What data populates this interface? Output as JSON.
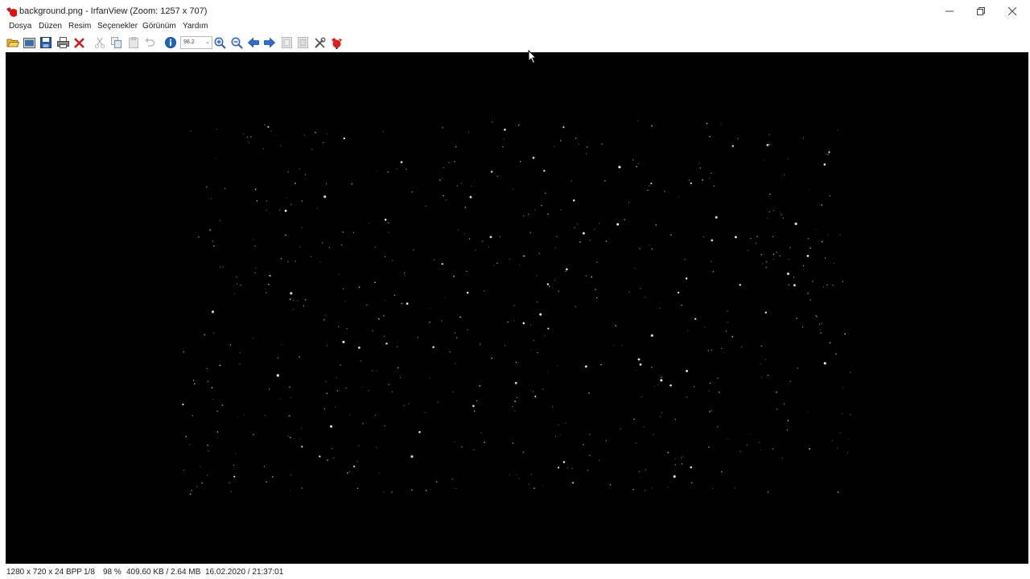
{
  "window": {
    "title": "background.png - IrfanView (Zoom: 1257 x 707)"
  },
  "menu": {
    "items": [
      "Dosya",
      "Düzen",
      "Resim",
      "Seçenekler",
      "Görünüm",
      "Yardım"
    ]
  },
  "toolbar": {
    "zoom_value": "98.2",
    "icons": [
      "open-folder-icon",
      "thumbnails-icon",
      "save-icon",
      "print-icon",
      "delete-icon",
      "cut-icon",
      "copy-icon",
      "paste-icon",
      "undo-icon",
      "info-icon",
      "zoom-in-icon",
      "zoom-out-icon",
      "previous-icon",
      "next-icon",
      "fit-page-icon",
      "fit-page-2-icon",
      "settings-icon",
      "irfan-logo-icon"
    ]
  },
  "status": {
    "dimensions": "1280 x 720 x 24 BPP",
    "index": "1/8",
    "zoom": "98 %",
    "size": "409.60 KB / 2.64 MB",
    "datetime": "16.02.2020 / 21:37:01"
  },
  "colors": {
    "viewer_background": "#000000",
    "star": "#ffffff",
    "accent_red": "#e02020"
  }
}
